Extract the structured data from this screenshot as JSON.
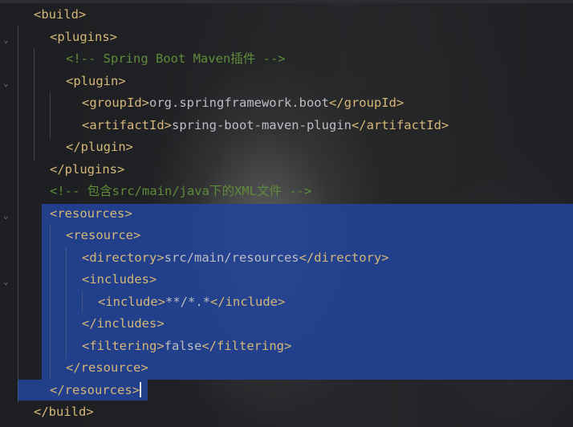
{
  "editor": {
    "language": "xml",
    "lines": [
      {
        "open": "<build>",
        "text": "",
        "close": "",
        "comment": ""
      },
      {
        "open": "<plugins>",
        "text": "",
        "close": "",
        "comment": ""
      },
      {
        "open": "",
        "text": "",
        "close": "",
        "comment": "<!-- Spring Boot Maven插件 -->"
      },
      {
        "open": "<plugin>",
        "text": "",
        "close": "",
        "comment": ""
      },
      {
        "open": "<groupId>",
        "text": "org.springframework.boot",
        "close": "</groupId>",
        "comment": ""
      },
      {
        "open": "<artifactId>",
        "text": "spring-boot-maven-plugin",
        "close": "</artifactId>",
        "comment": ""
      },
      {
        "open": "</plugin>",
        "text": "",
        "close": "",
        "comment": ""
      },
      {
        "open": "</plugins>",
        "text": "",
        "close": "",
        "comment": ""
      },
      {
        "open": "",
        "text": "",
        "close": "",
        "comment": "<!-- 包含src/main/java下的XML文件 -->"
      },
      {
        "open": "<resources>",
        "text": "",
        "close": "",
        "comment": ""
      },
      {
        "open": "<resource>",
        "text": "",
        "close": "",
        "comment": ""
      },
      {
        "open": "<directory>",
        "text": "src/main/resources",
        "close": "</directory>",
        "comment": ""
      },
      {
        "open": "<includes>",
        "text": "",
        "close": "",
        "comment": ""
      },
      {
        "open": "<include>",
        "text": "**/*.*",
        "close": "</include>",
        "comment": ""
      },
      {
        "open": "</includes>",
        "text": "",
        "close": "",
        "comment": ""
      },
      {
        "open": "<filtering>",
        "text": "false",
        "close": "</filtering>",
        "comment": ""
      },
      {
        "open": "</resource>",
        "text": "",
        "close": "",
        "comment": ""
      },
      {
        "open": "</resources>",
        "text": "",
        "close": "",
        "comment": ""
      },
      {
        "open": "</build>",
        "text": "",
        "close": "",
        "comment": ""
      }
    ]
  },
  "colors": {
    "tag": "#d5b778",
    "text": "#bcbec4",
    "comment": "#5f8c3a",
    "selection": "#2142a0",
    "background": "#1e1f22"
  },
  "icons": [
    "fold-chevron-icon",
    "text-caret"
  ]
}
